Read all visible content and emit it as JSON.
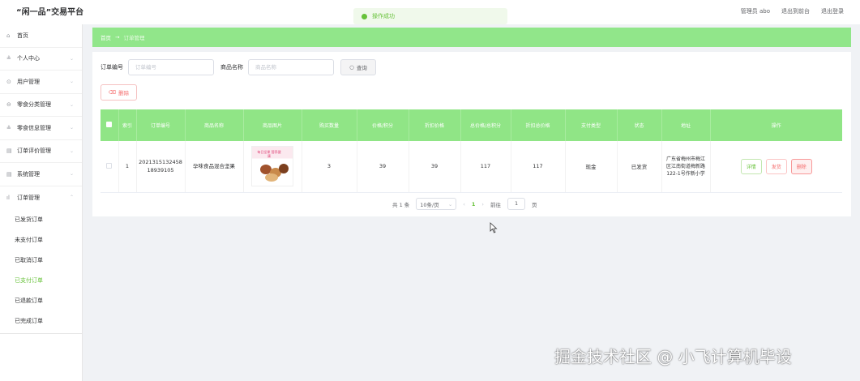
{
  "app": {
    "title": "“闲一品”交易平台"
  },
  "topbar": {
    "admin_label": "管理员 abo",
    "back_label": "退出到前台",
    "logout_label": "退出登录"
  },
  "toast": {
    "text": "操作成功",
    "color": "#67c23a"
  },
  "sidebar": {
    "items": [
      {
        "icon": "home-icon",
        "glyph": "⌂",
        "label": "首页",
        "has_children": false
      },
      {
        "icon": "user-icon",
        "glyph": "≗",
        "label": "个人中心",
        "has_children": true
      },
      {
        "icon": "user-manage-icon",
        "glyph": "⊙",
        "label": "用户管理",
        "has_children": true
      },
      {
        "icon": "category-icon",
        "glyph": "⊖",
        "label": "零食分类管理",
        "has_children": true
      },
      {
        "icon": "snack-icon",
        "glyph": "≗",
        "label": "零食信息管理",
        "has_children": true
      },
      {
        "icon": "comment-icon",
        "glyph": "▤",
        "label": "订单评价管理",
        "has_children": true
      },
      {
        "icon": "system-icon",
        "glyph": "▤",
        "label": "系统管理",
        "has_children": true
      },
      {
        "icon": "order-icon",
        "glyph": "ıl",
        "label": "订单管理",
        "has_children": true,
        "expanded": true
      }
    ],
    "sub_items": [
      {
        "label": "已发货订单",
        "active": false
      },
      {
        "label": "未支付订单",
        "active": false
      },
      {
        "label": "已取消订单",
        "active": false
      },
      {
        "label": "已支付订单",
        "active": true
      },
      {
        "label": "已退款订单",
        "active": false
      },
      {
        "label": "已完成订单",
        "active": false
      }
    ]
  },
  "breadcrumb": {
    "home": "首页",
    "separator": "→",
    "current": "订单管理"
  },
  "search": {
    "order_no_label": "订单编号",
    "order_no_placeholder": "订单编号",
    "product_label": "商品名称",
    "product_placeholder": "商品名称",
    "button": "查询"
  },
  "delete_button": "删除",
  "table": {
    "headers": [
      "",
      "索引",
      "订单编号",
      "商品名称",
      "商品图片",
      "购买数量",
      "价格/积分",
      "折扣价格",
      "总价格/总积分",
      "折扣总价格",
      "支付类型",
      "状态",
      "地址",
      "操作"
    ],
    "rows": [
      {
        "index": "1",
        "order_no": "202131513245818939105",
        "product": "孕味食品混合坚果",
        "image_caption": "每日坚果 营养健康",
        "quantity": "3",
        "price": "39",
        "discount_price": "39",
        "total": "117",
        "discount_total": "117",
        "pay_type": "现金",
        "status": "已发货",
        "address": "广东省梅州市梅江区江南街道梅新路122-1号作新小学",
        "actions": [
          "详情",
          "发货",
          "删除"
        ]
      }
    ]
  },
  "pagination": {
    "total": "共 1 条",
    "page_size": "10条/页",
    "current": "1",
    "goto_label": "前往",
    "goto_value": "1",
    "page_unit": "页"
  },
  "watermark": "掘金技术社区 @ 小飞计算机毕设",
  "colors": {
    "accent": "#90e586",
    "primary": "#67c23a",
    "danger": "#f56c6c"
  }
}
